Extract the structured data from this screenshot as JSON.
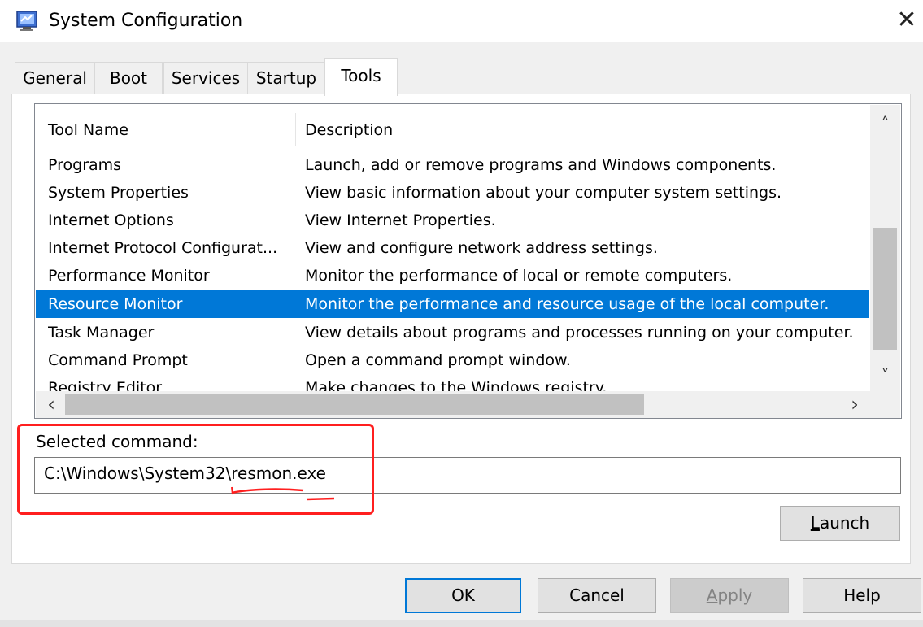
{
  "window": {
    "title": "System Configuration",
    "close_glyph": "✕",
    "icon": "msconfig-app-icon"
  },
  "tabs": [
    {
      "label": "General",
      "active": false
    },
    {
      "label": "Boot",
      "active": false
    },
    {
      "label": "Services",
      "active": false
    },
    {
      "label": "Startup",
      "active": false
    },
    {
      "label": "Tools",
      "active": true
    }
  ],
  "tools_table": {
    "columns": [
      "Tool Name",
      "Description"
    ],
    "rows": [
      {
        "name": "Programs",
        "description": "Launch, add or remove programs and Windows components.",
        "selected": false
      },
      {
        "name": "System Properties",
        "description": "View basic information about your computer system settings.",
        "selected": false
      },
      {
        "name": "Internet Options",
        "description": "View Internet Properties.",
        "selected": false
      },
      {
        "name": "Internet Protocol Configurat...",
        "description": "View and configure network address settings.",
        "selected": false
      },
      {
        "name": "Performance Monitor",
        "description": "Monitor the performance of local or remote computers.",
        "selected": false
      },
      {
        "name": "Resource Monitor",
        "description": "Monitor the performance and resource usage of the local computer.",
        "selected": true
      },
      {
        "name": "Task Manager",
        "description": "View details about programs and processes running on your computer.",
        "selected": false
      },
      {
        "name": "Command Prompt",
        "description": "Open a command prompt window.",
        "selected": false
      },
      {
        "name": "Registry Editor",
        "description": "Make changes to the Windows registry.",
        "selected": false
      }
    ]
  },
  "scroll": {
    "up_glyph": "˄",
    "down_glyph": "˅",
    "left_glyph": "‹",
    "right_glyph": "›"
  },
  "selected_command": {
    "label": "Selected command:",
    "value": "C:\\Windows\\System32\\resmon.exe"
  },
  "buttons": {
    "launch_prefix": "L",
    "launch_rest": "aunch",
    "ok": "OK",
    "cancel": "Cancel",
    "apply_prefix": "A",
    "apply_rest": "pply",
    "help": "Help"
  },
  "colors": {
    "selection": "#0078d7",
    "annotation": "#ff1f1f"
  }
}
